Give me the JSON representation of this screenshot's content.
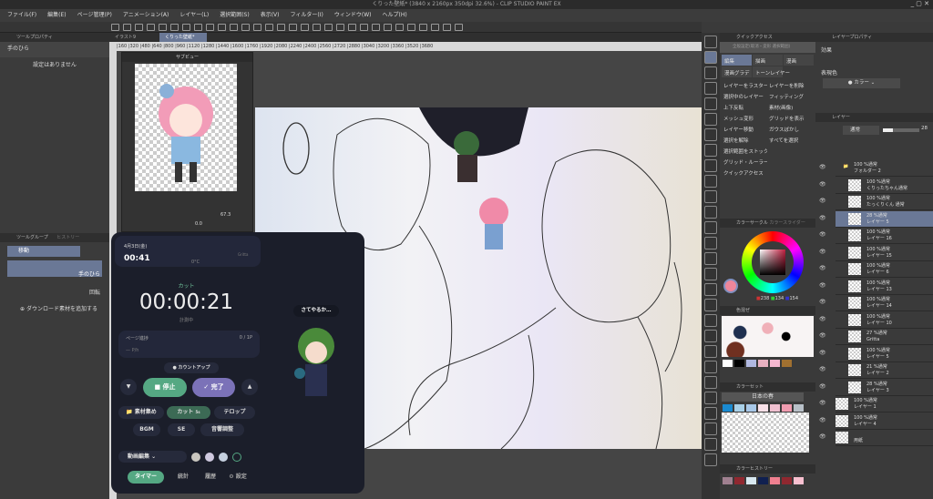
{
  "title": "くりった壁紙* (3840 x 2160px 350dpi 32.6%) - CLIP STUDIO PAINT EX",
  "menu": [
    "ファイル(F)",
    "編集(E)",
    "ページ管理(P)",
    "アニメーション(A)",
    "レイヤー(L)",
    "選択範囲(S)",
    "表示(V)",
    "フィルター(I)",
    "ウィンドウ(W)",
    "ヘルプ(H)"
  ],
  "tool_property": {
    "tab": "ツールプロパティ",
    "tool": "手のひら",
    "empty": "設定はありません"
  },
  "tool_group": {
    "tab": "ツールグループ",
    "tab2": "ヒストリー",
    "group": "移動",
    "sub1": "手のひら",
    "sub2": "回転",
    "download": "ダウンロード素材を追加する"
  },
  "doc_tabs": [
    "イラスト9",
    "くりった壁紙*"
  ],
  "ruler": "|160 |320 |480 |640 |800 |960 |1120 |1280 |1440 |1600 |1760 |1920 |2080 |2240 |2400 |2560 |2720 |2880 |3040 |3200 |3360 |3520 |3680",
  "subview": {
    "title": "サブビュー",
    "zoom": "67.3",
    "angle": "0.0"
  },
  "widget": {
    "date": "4月3日(金)",
    "time": "00:41",
    "weather": "0°C",
    "app": "Gritta",
    "mode": "カット",
    "timer": "00:00:21",
    "status": "計測中",
    "progress_label": "ページ進捗",
    "progress_value": "0 / 1P",
    "rate": "— P/h",
    "countup": "カウントアップ",
    "stop": "停止",
    "done": "完了",
    "cats": [
      "素材集め",
      "カット",
      "テロップ",
      "BGM",
      "SE",
      "音響調整"
    ],
    "cut_badge": "5s",
    "select": "動画編集",
    "nav": [
      "タイマー",
      "統計",
      "履歴",
      "設定"
    ],
    "speech": "さてやるか…",
    "colors": [
      "#c9c6bf",
      "#cfc9df",
      "#c5d0df"
    ]
  },
  "quick_access": {
    "tab": "クイックアクセス",
    "set": "全般設定(取消・変形 選択範囲)",
    "tabs": [
      "編集",
      "描画",
      "漫画",
      "漫画グラデ",
      "トーンレイヤー"
    ],
    "items": [
      "レイヤーをラスター",
      "レイヤーを削除",
      "選択中のレイヤー",
      "フィッティング",
      "上下反転",
      "素材(画像)",
      "メッシュ変形",
      "グリッドを表示",
      "レイヤー移動",
      "ガウスぼかし",
      "選択を解除",
      "すべてを選択",
      "選択範囲をストック",
      "グリッド・ルーラー",
      "クイックアクセス"
    ]
  },
  "layer_property": {
    "tab": "レイヤープロパティ",
    "effect": "効果",
    "display_color": "表現色",
    "color_mode": "カラー"
  },
  "layers": {
    "tab": "レイヤー",
    "blend": "通常",
    "opacity": "28",
    "rows": [
      {
        "mode": "100 %通常",
        "name": "フォルダー 2",
        "folder": true
      },
      {
        "mode": "100 %通常",
        "name": "くりったちゃん通常"
      },
      {
        "mode": "100 %通常",
        "name": "たっくりくん 通常"
      },
      {
        "mode": "28 %通常",
        "name": "レイヤー 5",
        "selected": true
      },
      {
        "mode": "100 %通常",
        "name": "レイヤー 16"
      },
      {
        "mode": "100 %通常",
        "name": "レイヤー 15"
      },
      {
        "mode": "100 %通常",
        "name": "レイヤー 6"
      },
      {
        "mode": "100 %通常",
        "name": "レイヤー 13"
      },
      {
        "mode": "100 %通常",
        "name": "レイヤー 14"
      },
      {
        "mode": "100 %通常",
        "name": "レイヤー 10"
      },
      {
        "mode": "27 %通常",
        "name": "Gritta"
      },
      {
        "mode": "100 %通常",
        "name": "レイヤー 5"
      },
      {
        "mode": "21 %通常",
        "name": "レイヤー 2"
      },
      {
        "mode": "28 %通常",
        "name": "レイヤー 3"
      },
      {
        "mode": "100 %通常",
        "name": "レイヤー 1"
      },
      {
        "mode": "100 %通常",
        "name": "レイヤー 4"
      },
      {
        "mode": "",
        "name": "用紙"
      }
    ]
  },
  "color_circle": {
    "tab": "カラーサークル",
    "tab2": "カラースライダー",
    "r": "238",
    "g": "134",
    "b": "154",
    "main": "#ee869a"
  },
  "color_mix": {
    "tab": "色混ぜ",
    "swatches": [
      "#ffffff",
      "#000000",
      "#b0b8e0",
      "#e8b0c0",
      "#f5b8d0",
      "#a07030"
    ]
  },
  "color_set": {
    "tab": "カラーセット",
    "name": "日本の春",
    "colors": [
      "#1a8ad0",
      "#a8d0e8",
      "#a8c8e8",
      "#f8e0e8",
      "#f0c0d0",
      "#f09cb0",
      "#b8c0c8",
      "#d8e0e8",
      "#e0e8f0"
    ]
  },
  "color_history": {
    "tab": "カラーヒストリー",
    "colors": [
      "#a08090",
      "#902830",
      "#d8e8f0",
      "#102050",
      "#f08090",
      "#902830",
      "#f8c0d0"
    ]
  }
}
